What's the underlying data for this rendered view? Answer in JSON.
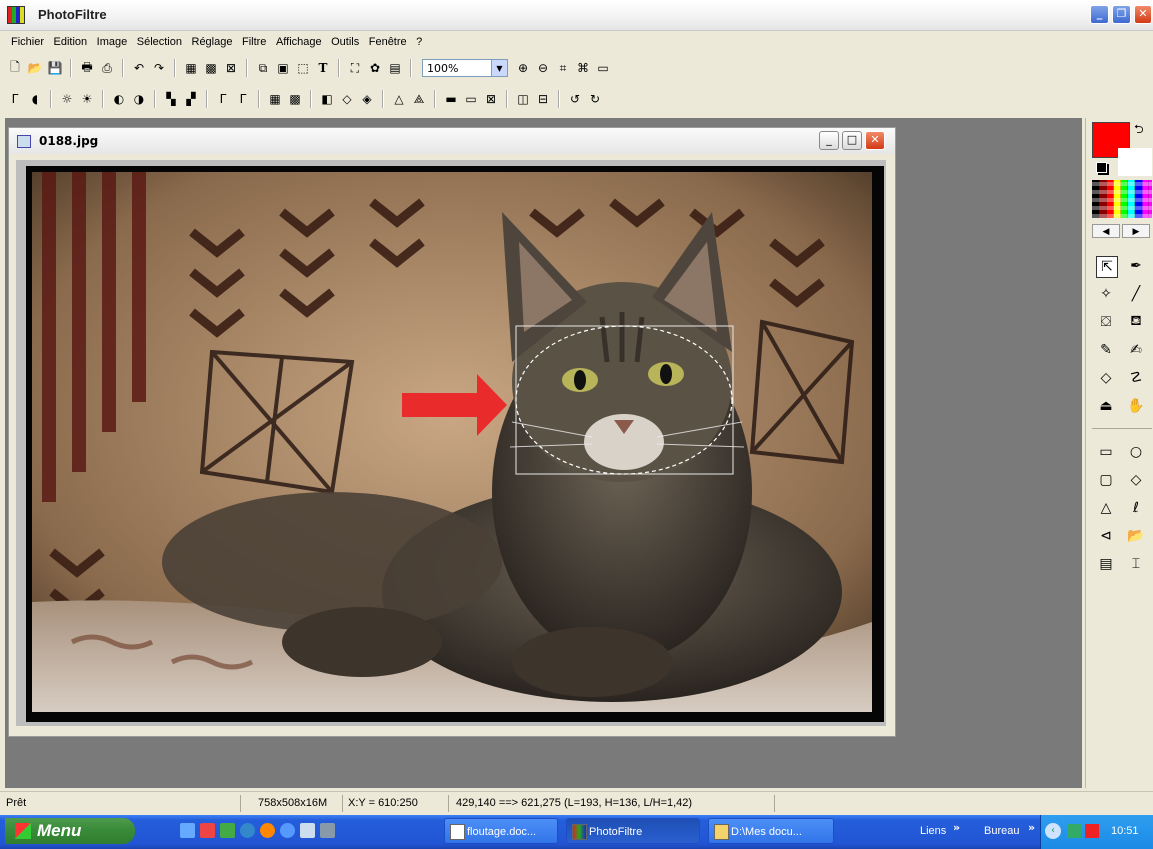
{
  "app": {
    "title": "PhotoFiltre"
  },
  "menu": [
    "Fichier",
    "Edition",
    "Image",
    "Sélection",
    "Réglage",
    "Filtre",
    "Affichage",
    "Outils",
    "Fenêtre",
    "?"
  ],
  "toolbar": {
    "zoom": "100%"
  },
  "document": {
    "title": "0188.jpg"
  },
  "status": {
    "state": "Prêt",
    "image_info": "758x508x16M",
    "cursor": "X:Y = 610:250",
    "selection": "429,140 ==> 621,275 (L=193, H=136, L/H=1,42)"
  },
  "taskbar": {
    "start_label": "Menu",
    "tasks": [
      "floutage.doc...",
      "PhotoFiltre",
      "D:\\Mes docu..."
    ],
    "links_label": "Liens",
    "desktop_label": "Bureau",
    "clock": "10:51"
  },
  "colors": {
    "foreground": "#ff0000",
    "background": "#ffffff",
    "arrow": "#ea2b2b",
    "taskbar": "#245edb",
    "workspace": "#7a7a7a"
  }
}
